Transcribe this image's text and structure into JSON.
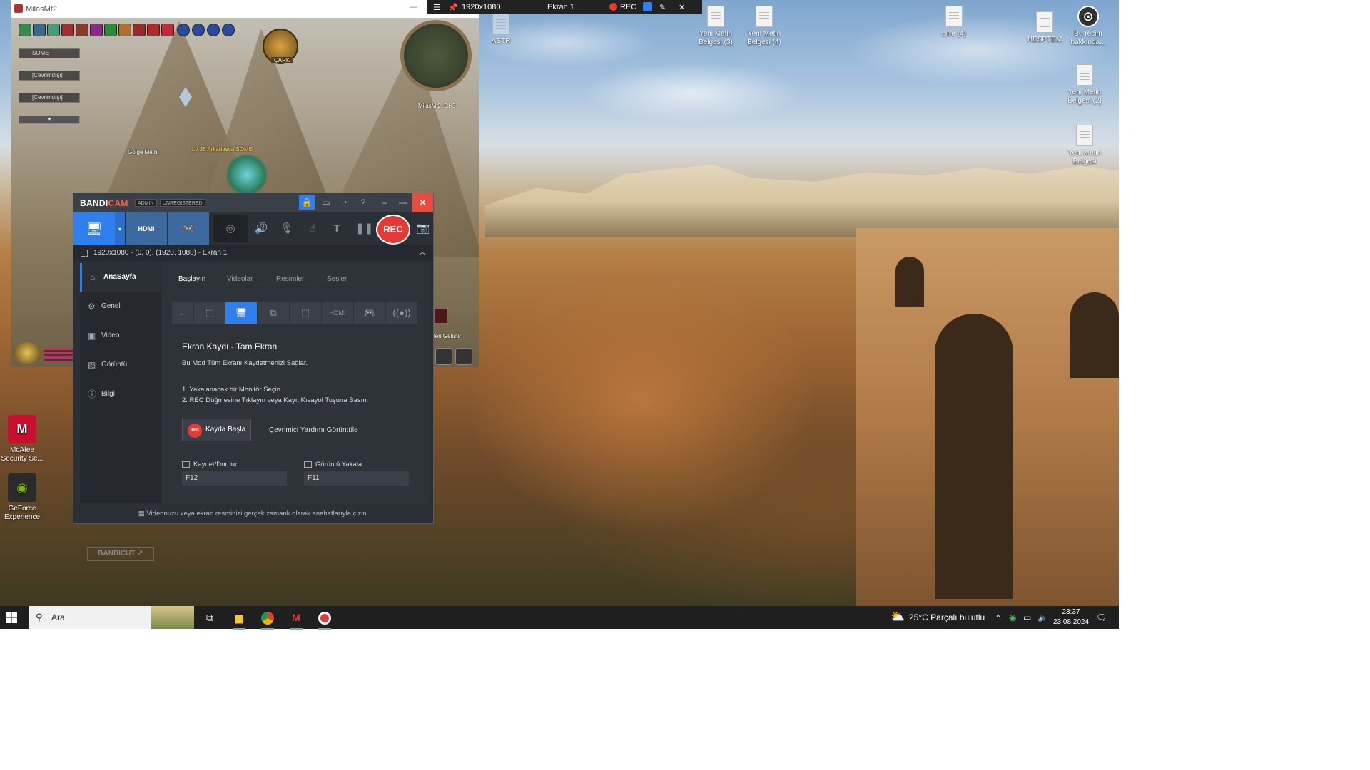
{
  "recording_bar": {
    "resolution": "1920x1080",
    "screen": "Ekran 1",
    "rec_label": "REC"
  },
  "desktop_icons": {
    "astr": "ASTR",
    "doc3": "Yeni Metin Belgesi (3)",
    "doc4": "Yeni Metin Belgesi (4)",
    "sifre": "sifre (4)",
    "hesptem": "HESPTEM",
    "bu_resim": "Bu resim hakkında...",
    "doc2": "Yeni Metin Belgesi (2)",
    "doc1": "Yeni Metin Belgesi",
    "mcafee": "McAfee Security Sc...",
    "geforce": "GeForce Experience"
  },
  "game": {
    "window_title": "MilasMt2",
    "party_1": "SOME",
    "party_2": "[Çevrimdışı]",
    "party_3": "[Çevrimdışı]",
    "cark": "ÇARK",
    "minimap_label": "MilasMt2, CH3",
    "npc_1": "Gölge Metni",
    "player_name": "Lv 38 Arkadaşça SOME",
    "side_label": "leri Geliştir"
  },
  "bandicam": {
    "logo_bandi": "BANDI",
    "logo_cam": "CAM",
    "tag_admin": "ADMIN",
    "tag_unregistered": "UNREGISTERED",
    "rec_label": "REC",
    "target_text": "1920x1080 - (0, 0), (1920, 1080) - Ekran 1",
    "sidebar": {
      "home": "AnaSayfa",
      "general": "Genel",
      "video": "Video",
      "image": "Görüntü",
      "info": "Bilgi"
    },
    "bandicut": "BANDICUT",
    "tabs": {
      "start": "Başlayın",
      "videos": "Videolar",
      "images": "Resimler",
      "sounds": "Sesler"
    },
    "heading": "Ekran Kaydı - Tam Ekran",
    "description": "Bu Mod Tüm Ekranı Kaydetmenizi Sağlar.",
    "step1": "1. Yakalanacak bir Monitör Seçin.",
    "step2": "2. REC Düğmesine Tıklayın veya Kayıt Kısayol Tuşuna Basın.",
    "start_button": "Kayda Başla",
    "start_button_badge": "REC",
    "help_link": "Çevrimiçi Yardımı Görüntüle",
    "hotkey_record_label": "Kaydet/Durdur",
    "hotkey_record_value": "F12",
    "hotkey_capture_label": "Görüntü Yakala",
    "hotkey_capture_value": "F11",
    "footer": "Videonuzu veya ekran resminizi gerçek zamanlı olarak anahatlarıyla çizin."
  },
  "taskbar": {
    "search_placeholder": "Ara",
    "weather": "25°C  Parçalı bulutlu",
    "time": "23:37",
    "date": "23.08.2024"
  },
  "colors": {
    "bandicam_accent": "#2f80ed",
    "rec_red": "#e53935"
  }
}
